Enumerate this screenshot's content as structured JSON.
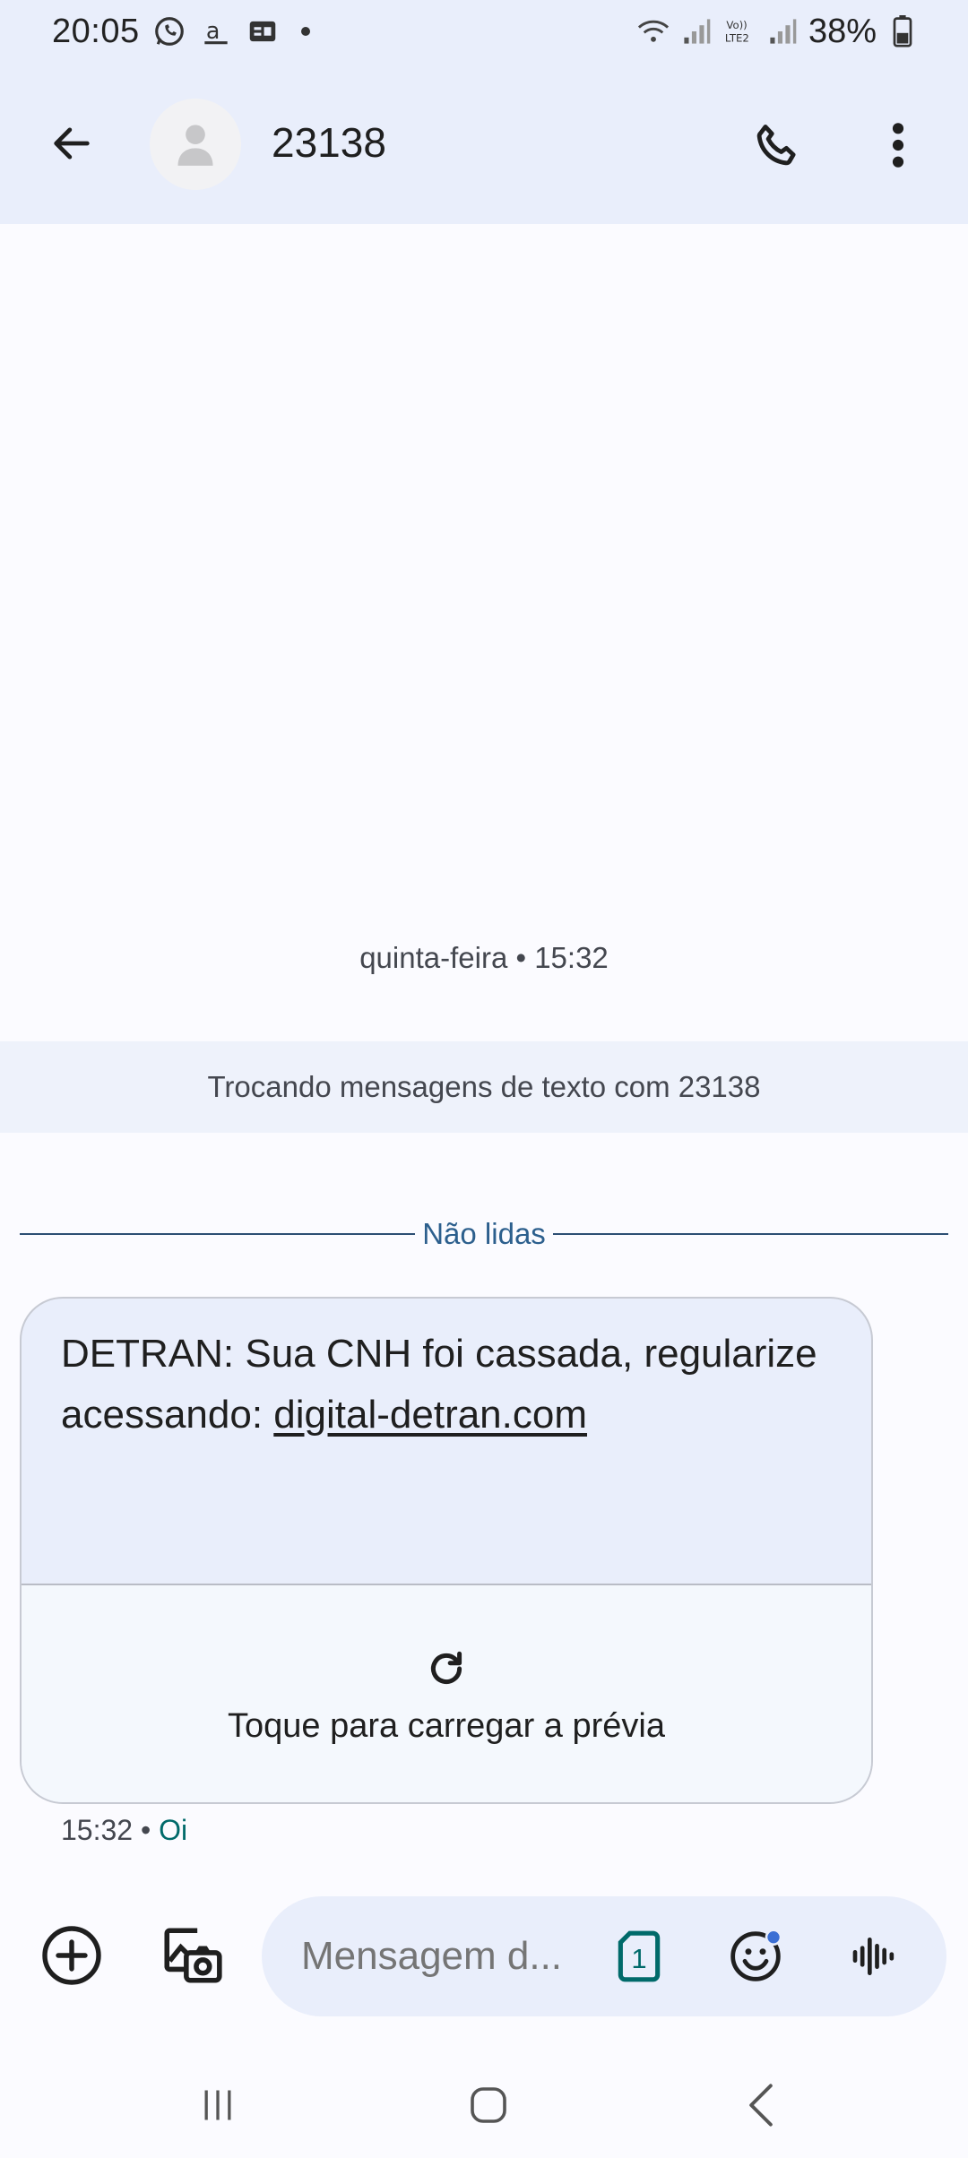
{
  "status_bar": {
    "time": "20:05",
    "battery": "38%",
    "notification_icons": [
      "whatsapp-icon",
      "amazon-icon",
      "news-icon"
    ],
    "system_icons": [
      "wifi-icon",
      "signal-icon",
      "volte-icon",
      "signal-icon",
      "battery-icon"
    ]
  },
  "header": {
    "contact": "23138",
    "icons": [
      "back-arrow-icon",
      "avatar-person-icon",
      "phone-icon",
      "more-vert-icon"
    ]
  },
  "conversation": {
    "date_label": "quinta-feira • 15:32",
    "info_banner": "Trocando mensagens de texto com 23138",
    "unread_label": "Não lidas",
    "message": {
      "text": "DETRAN: Sua CNH foi cassada, regularize acessando: ",
      "link": "digital-detran.com",
      "preview_label": "Toque para carregar a prévia",
      "time": "15:32",
      "separator": " • ",
      "sim": "Oi"
    }
  },
  "compose": {
    "placeholder": "Mensagem d...",
    "sim_number": "1",
    "icons": [
      "add-circle-icon",
      "gallery-camera-icon",
      "sim-icon",
      "emoji-icon",
      "voice-wave-icon"
    ]
  },
  "nav": {
    "icons": [
      "recents-icon",
      "home-icon",
      "back-icon"
    ]
  },
  "colors": {
    "header_bg": "#e9eefb",
    "accent_teal": "#006a6a",
    "divider_blue": "#2c4f73",
    "emoji_badge": "#3b6fd4"
  }
}
